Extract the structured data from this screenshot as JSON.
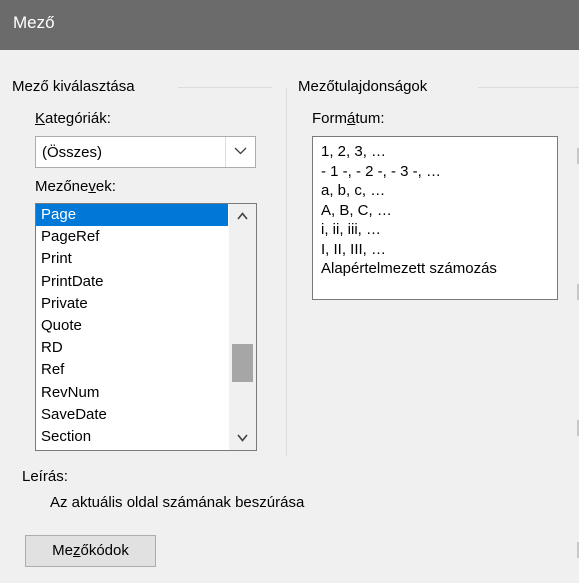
{
  "window": {
    "title": "Mező"
  },
  "left_group": {
    "title": "Mező kiválasztása",
    "categories_label_first": "K",
    "categories_label_rest": "ategóriák:",
    "categories_value": "(Összes)",
    "field_names_label_pre": "Mezőne",
    "field_names_label_u": "v",
    "field_names_label_post": "ek:",
    "field_names": [
      "Page",
      "PageRef",
      "Print",
      "PrintDate",
      "Private",
      "Quote",
      "RD",
      "Ref",
      "RevNum",
      "SaveDate",
      "Section"
    ],
    "selected_field": "Page"
  },
  "right_group": {
    "title": "Mezőtulajdonságok",
    "format_label_pre": "Form",
    "format_label_u": "á",
    "format_label_post": "tum:",
    "formats": [
      "1, 2, 3, …",
      "- 1 -, - 2 -, - 3 -, …",
      "a, b, c, …",
      "A, B, C, …",
      "i, ii, iii, …",
      "I, II, III, …",
      "Alapértelmezett számozás"
    ]
  },
  "description": {
    "label": "Leírás:",
    "text": "Az aktuális oldal számának beszúrása"
  },
  "field_codes_button": {
    "pre": "Me",
    "u": "z",
    "post": "őkódok"
  },
  "icons": {
    "combo_arrow": "chevron-down-icon",
    "scroll_up": "chevron-up-icon",
    "scroll_down": "chevron-down-icon"
  }
}
